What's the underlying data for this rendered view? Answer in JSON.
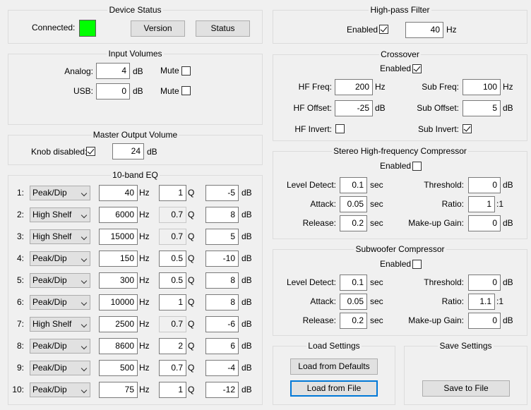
{
  "device_status": {
    "title": "Device Status",
    "connected_label": "Connected:",
    "connected_color": "#00ff00",
    "version_button": "Version",
    "status_button": "Status"
  },
  "input_volumes": {
    "title": "Input Volumes",
    "analog_label": "Analog:",
    "analog_value": "4",
    "usb_label": "USB:",
    "usb_value": "0",
    "unit": "dB",
    "mute_label": "Mute",
    "analog_mute": false,
    "usb_mute": false
  },
  "master_volume": {
    "title": "Master Output Volume",
    "knob_label": "Knob disabled:",
    "knob_disabled": true,
    "value": "24",
    "unit": "dB"
  },
  "eq": {
    "title": "10-band EQ",
    "freq_unit": "Hz",
    "q_unit": "Q",
    "gain_unit": "dB",
    "bands": [
      {
        "num": "1:",
        "type": "Peak/Dip",
        "freq": "40",
        "q": "1",
        "gain": "-5",
        "q_readonly": false
      },
      {
        "num": "2:",
        "type": "High Shelf",
        "freq": "6000",
        "q": "0.7",
        "gain": "8",
        "q_readonly": true
      },
      {
        "num": "3:",
        "type": "High Shelf",
        "freq": "15000",
        "q": "0.7",
        "gain": "5",
        "q_readonly": true
      },
      {
        "num": "4:",
        "type": "Peak/Dip",
        "freq": "150",
        "q": "0.5",
        "gain": "-10",
        "q_readonly": false
      },
      {
        "num": "5:",
        "type": "Peak/Dip",
        "freq": "300",
        "q": "0.5",
        "gain": "8",
        "q_readonly": false
      },
      {
        "num": "6:",
        "type": "Peak/Dip",
        "freq": "10000",
        "q": "1",
        "gain": "8",
        "q_readonly": false
      },
      {
        "num": "7:",
        "type": "High Shelf",
        "freq": "2500",
        "q": "0.7",
        "gain": "-6",
        "q_readonly": true
      },
      {
        "num": "8:",
        "type": "Peak/Dip",
        "freq": "8600",
        "q": "2",
        "gain": "6",
        "q_readonly": false
      },
      {
        "num": "9:",
        "type": "Peak/Dip",
        "freq": "500",
        "q": "0.7",
        "gain": "-4",
        "q_readonly": false
      },
      {
        "num": "10:",
        "type": "Peak/Dip",
        "freq": "75",
        "q": "1",
        "gain": "-12",
        "q_readonly": false
      }
    ]
  },
  "highpass": {
    "title": "High-pass Filter",
    "enabled_label": "Enabled",
    "enabled": true,
    "value": "40",
    "unit": "Hz"
  },
  "crossover": {
    "title": "Crossover",
    "enabled_label": "Enabled",
    "enabled": true,
    "hf_freq_label": "HF Freq:",
    "hf_freq": "200",
    "hf_offset_label": "HF Offset:",
    "hf_offset": "-25",
    "hf_invert_label": "HF Invert:",
    "hf_invert": false,
    "sub_freq_label": "Sub Freq:",
    "sub_freq": "100",
    "sub_offset_label": "Sub Offset:",
    "sub_offset": "5",
    "sub_invert_label": "Sub Invert:",
    "sub_invert": true,
    "hz": "Hz",
    "db": "dB"
  },
  "hf_compressor": {
    "title": "Stereo High-frequency Compressor",
    "enabled_label": "Enabled",
    "enabled": false,
    "level_detect_label": "Level Detect:",
    "level_detect": "0.1",
    "attack_label": "Attack:",
    "attack": "0.05",
    "release_label": "Release:",
    "release": "0.2",
    "sec": "sec",
    "threshold_label": "Threshold:",
    "threshold": "0",
    "ratio_label": "Ratio:",
    "ratio": "1",
    "ratio_suffix": ":1",
    "makeup_label": "Make-up Gain:",
    "makeup": "0",
    "db": "dB"
  },
  "sub_compressor": {
    "title": "Subwoofer Compressor",
    "enabled_label": "Enabled",
    "enabled": false,
    "level_detect_label": "Level Detect:",
    "level_detect": "0.1",
    "attack_label": "Attack:",
    "attack": "0.05",
    "release_label": "Release:",
    "release": "0.2",
    "sec": "sec",
    "threshold_label": "Threshold:",
    "threshold": "0",
    "ratio_label": "Ratio:",
    "ratio": "1.1",
    "ratio_suffix": ":1",
    "makeup_label": "Make-up Gain:",
    "makeup": "0",
    "db": "dB"
  },
  "load_settings": {
    "title": "Load Settings",
    "defaults_button": "Load from Defaults",
    "file_button": "Load from File"
  },
  "save_settings": {
    "title": "Save Settings",
    "file_button": "Save to File"
  }
}
